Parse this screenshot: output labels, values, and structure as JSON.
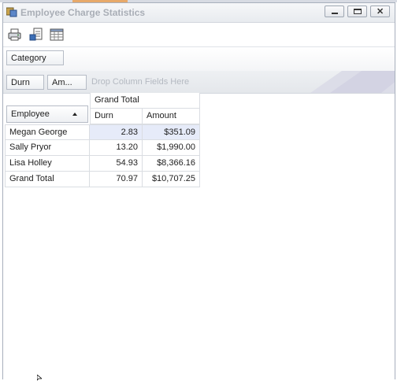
{
  "window": {
    "title": "Employee Charge Statistics"
  },
  "toolbar": {
    "buttons": [
      {
        "icon": "printer-icon"
      },
      {
        "icon": "export-icon"
      },
      {
        "icon": "field-list-icon"
      }
    ]
  },
  "filter_area": {
    "fields": [
      "Category"
    ]
  },
  "column_area": {
    "data_fields": [
      "Durn",
      "Am..."
    ],
    "drop_hint": "Drop Column Fields Here"
  },
  "pivot": {
    "row_field": "Employee",
    "row_sort": "ascending",
    "column_total_label": "Grand Total",
    "value_headers": [
      "Durn",
      "Amount"
    ],
    "rows": [
      {
        "employee": "Megan George",
        "durn": "2.83",
        "amount": "$351.09",
        "selected": true
      },
      {
        "employee": "Sally Pryor",
        "durn": "13.20",
        "amount": "$1,990.00"
      },
      {
        "employee": "Lisa Holley",
        "durn": "54.93",
        "amount": "$8,366.16"
      }
    ],
    "grand_total": {
      "label": "Grand Total",
      "durn": "70.97",
      "amount": "$10,707.25"
    }
  }
}
